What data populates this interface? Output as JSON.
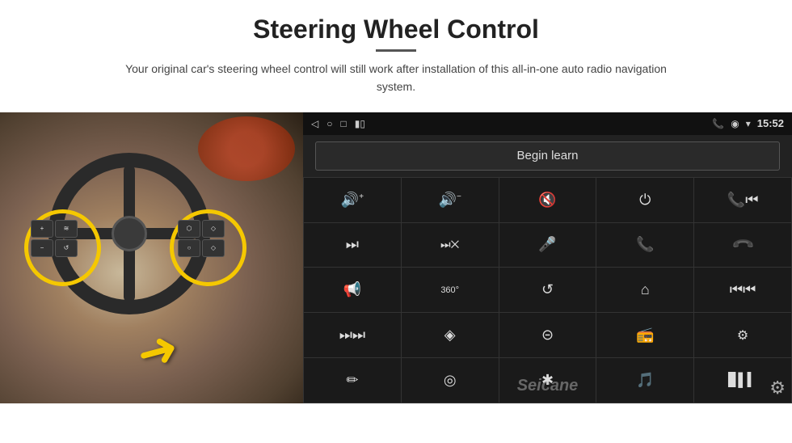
{
  "header": {
    "title": "Steering Wheel Control",
    "divider": true,
    "subtitle": "Your original car's steering wheel control will still work after installation of this all-in-one auto radio navigation system."
  },
  "status_bar": {
    "back_icon": "◁",
    "home_icon": "○",
    "recents_icon": "□",
    "battery_icon": "▮▯",
    "phone_icon": "📞",
    "location_icon": "◉",
    "wifi_icon": "▾",
    "time": "15:52"
  },
  "begin_learn": {
    "label": "Begin learn"
  },
  "control_grid": {
    "buttons": [
      {
        "icon": "🔊+",
        "label": "vol-up"
      },
      {
        "icon": "🔊−",
        "label": "vol-down"
      },
      {
        "icon": "🔇",
        "label": "mute"
      },
      {
        "icon": "⏻",
        "label": "power"
      },
      {
        "icon": "☎⏮",
        "label": "call-prev"
      },
      {
        "icon": "⏭",
        "label": "next-track"
      },
      {
        "icon": "⏭×",
        "label": "fast-fwd-skip"
      },
      {
        "icon": "🎤",
        "label": "mic"
      },
      {
        "icon": "📞",
        "label": "call"
      },
      {
        "icon": "↩",
        "label": "hang-up"
      },
      {
        "icon": "📢",
        "label": "horn"
      },
      {
        "icon": "360°",
        "label": "camera-360"
      },
      {
        "icon": "↺",
        "label": "back"
      },
      {
        "icon": "⌂",
        "label": "home"
      },
      {
        "icon": "⏮⏮",
        "label": "prev-track"
      },
      {
        "icon": "⏭⏭",
        "label": "fast-next"
      },
      {
        "icon": "◈",
        "label": "navigation"
      },
      {
        "icon": "⊝",
        "label": "eject"
      },
      {
        "icon": "📻",
        "label": "radio"
      },
      {
        "icon": "⚙",
        "label": "equalizer"
      },
      {
        "icon": "🖊",
        "label": "pen"
      },
      {
        "icon": "◎",
        "label": "settings-circle"
      },
      {
        "icon": "✱",
        "label": "bluetooth"
      },
      {
        "icon": "♪⚙",
        "label": "music-settings"
      },
      {
        "icon": "📊",
        "label": "spectrum"
      }
    ]
  },
  "watermark": {
    "text": "Seicane"
  },
  "icons": {
    "gear": "⚙"
  }
}
